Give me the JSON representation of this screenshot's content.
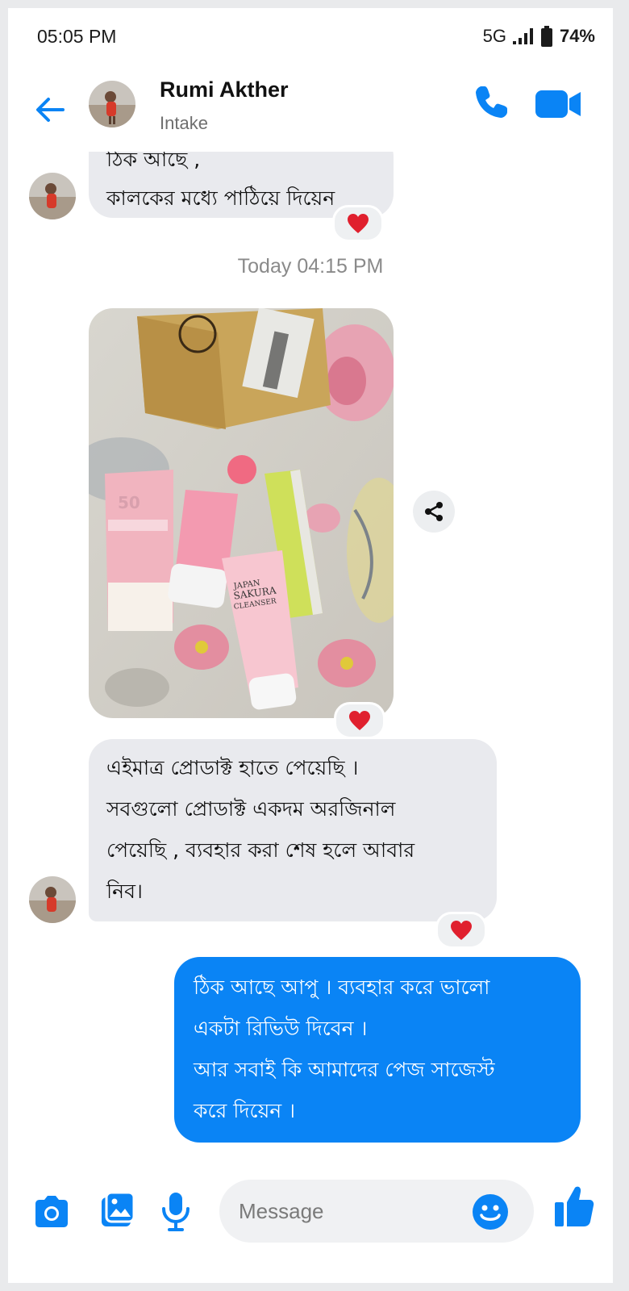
{
  "status": {
    "time": "05:05 PM",
    "network": "5G",
    "battery": "74%"
  },
  "header": {
    "name": "Rumi Akther",
    "subtitle": "Intake"
  },
  "messages": {
    "first": {
      "partial_line": "ঠিক আছে ,",
      "line": "কালকের মধ্যে পাঠিয়ে দিয়েন"
    },
    "timestamp": "Today 04:15 PM",
    "second": {
      "lines": [
        "এইমাত্র প্রোডাক্ট হাতে পেয়েছি ।",
        "সবগুলো প্রোডাক্ট একদম অরজিনাল",
        "পেয়েছি , ব্যবহার করা শেষ হলে আবার",
        "নিব।"
      ]
    },
    "reply": {
      "lines": [
        "ঠিক আছে আপু । ব্যবহার করে ভালো",
        "একটা রিভিউ দিবেন ।",
        "আর সবাই কি আমাদের পেজ সাজেস্ট",
        "করে দিয়েন ।"
      ]
    }
  },
  "photo": {
    "sunscreen_spf": "50",
    "cleanser_line1": "JAPAN",
    "cleanser_line2": "SAKURA",
    "cleanser_line3": "CLEANSER"
  },
  "composer": {
    "placeholder": "Message"
  },
  "colors": {
    "accent": "#0a84f5",
    "incoming": "#e9eaee",
    "reaction_heart": "#e0202e"
  },
  "icons": [
    "back-arrow-icon",
    "phone-icon",
    "video-icon",
    "heart-icon",
    "share-icon",
    "camera-icon",
    "gallery-icon",
    "microphone-icon",
    "emoji-icon",
    "thumbs-up-icon"
  ]
}
